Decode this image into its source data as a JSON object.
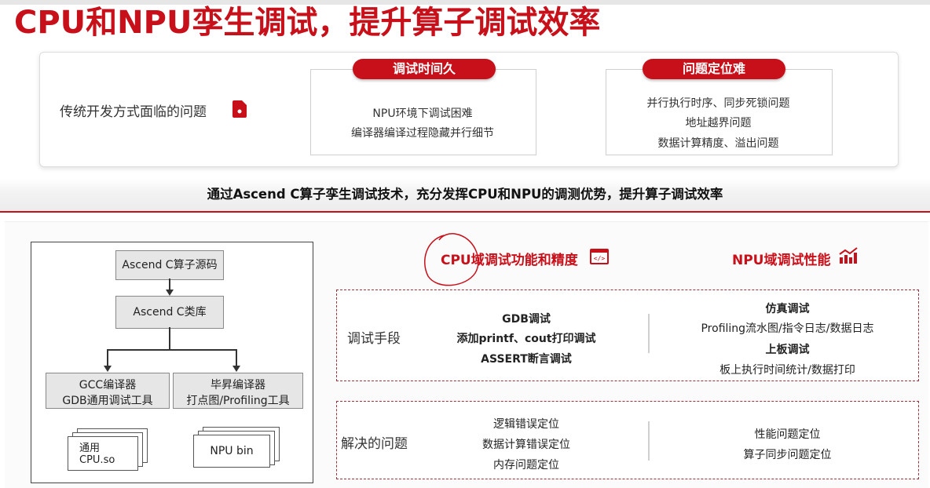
{
  "title": "CPU和NPU孪生调试，提升算子调试效率",
  "top_panel": {
    "label": "传统开发方式面临的问题",
    "problems": [
      {
        "title": "调试时间久",
        "lines": [
          "NPU环境下调试困难",
          "编译器编译过程隐藏并行细节"
        ]
      },
      {
        "title": "问题定位难",
        "lines": [
          "并行执行时序、同步死锁问题",
          "地址越界问题",
          "数据计算精度、溢出问题"
        ]
      }
    ]
  },
  "banner": "通过Ascend C算子孪生调试技术，充分发挥CPU和NPU的调测优势，提升算子调试效率",
  "flow": {
    "source": "Ascend C算子源码",
    "library": "Ascend C类库",
    "gcc_line1": "GCC编译器",
    "gcc_line2": "GDB通用调试工具",
    "ascend_line1": "毕昇编译器",
    "ascend_line2": "打点图/Profiling工具",
    "cpu_out_line1": "通用",
    "cpu_out_line2": "CPU.so",
    "npu_out": "NPU bin"
  },
  "columns": {
    "cpu_head": "CPU域调试功能和精度",
    "npu_head": "NPU域调试性能"
  },
  "rows": {
    "debug_label": "调试手段",
    "cpu_debug": [
      "GDB调试",
      "添加printf、cout打印调试",
      "ASSERT断言调试"
    ],
    "npu_debug_sim_title": "仿真调试",
    "npu_debug_sim": "Profiling流水图/指令日志/数据日志",
    "npu_debug_board_title": "上板调试",
    "npu_debug_board": "板上执行时间统计/数据打印",
    "solve_label": "解决的问题",
    "cpu_solve": [
      "逻辑错误定位",
      "数据计算错误定位",
      "内存问题定位"
    ],
    "npu_solve": [
      "性能问题定位",
      "算子同步问题定位"
    ]
  },
  "colors": {
    "accent": "#c8101a",
    "dashed": "#a0303a"
  }
}
